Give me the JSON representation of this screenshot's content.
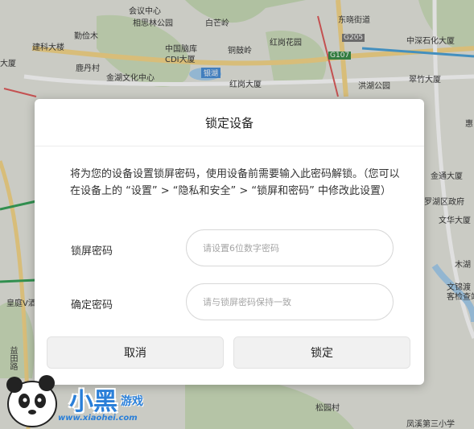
{
  "map": {
    "labels": [
      "相思林公园",
      "白芒岭",
      "东晓街道",
      "中深石化大厦",
      "勤俭木",
      "建科大楼",
      "中国脑库",
      "CDI大厦",
      "红岗花园",
      "铜鼓岭",
      "G205",
      "G107",
      "翠竹大厦",
      "大厦",
      "鹿丹村",
      "金湖文化中心",
      "银湖",
      "红岗大厦",
      "洪湖公园",
      "会议中心",
      "惠",
      "金通大厦",
      "罗湖区政府",
      "文华大厦",
      "木湖",
      "文锦渡",
      "客检查站",
      "皇庭V酒",
      "益田路",
      "松园村",
      "凤溪第三小学"
    ]
  },
  "dialog": {
    "title": "锁定设备",
    "description": "将为您的设备设置锁屏密码，使用设备前需要输入此密码解锁。（您可以在设备上的 “设置” > “隐私和安全” > “锁屏和密码” 中修改此设置）",
    "lock_password_label": "锁屏密码",
    "lock_password_placeholder": "请设置6位数字密码",
    "confirm_password_label": "确定密码",
    "confirm_password_placeholder": "请与锁屏密码保持一致",
    "cancel_label": "取消",
    "confirm_label": "锁定"
  },
  "watermark": {
    "brand_big": "小黑",
    "brand_small": "游戏",
    "url": "www.xiaohei.com"
  }
}
